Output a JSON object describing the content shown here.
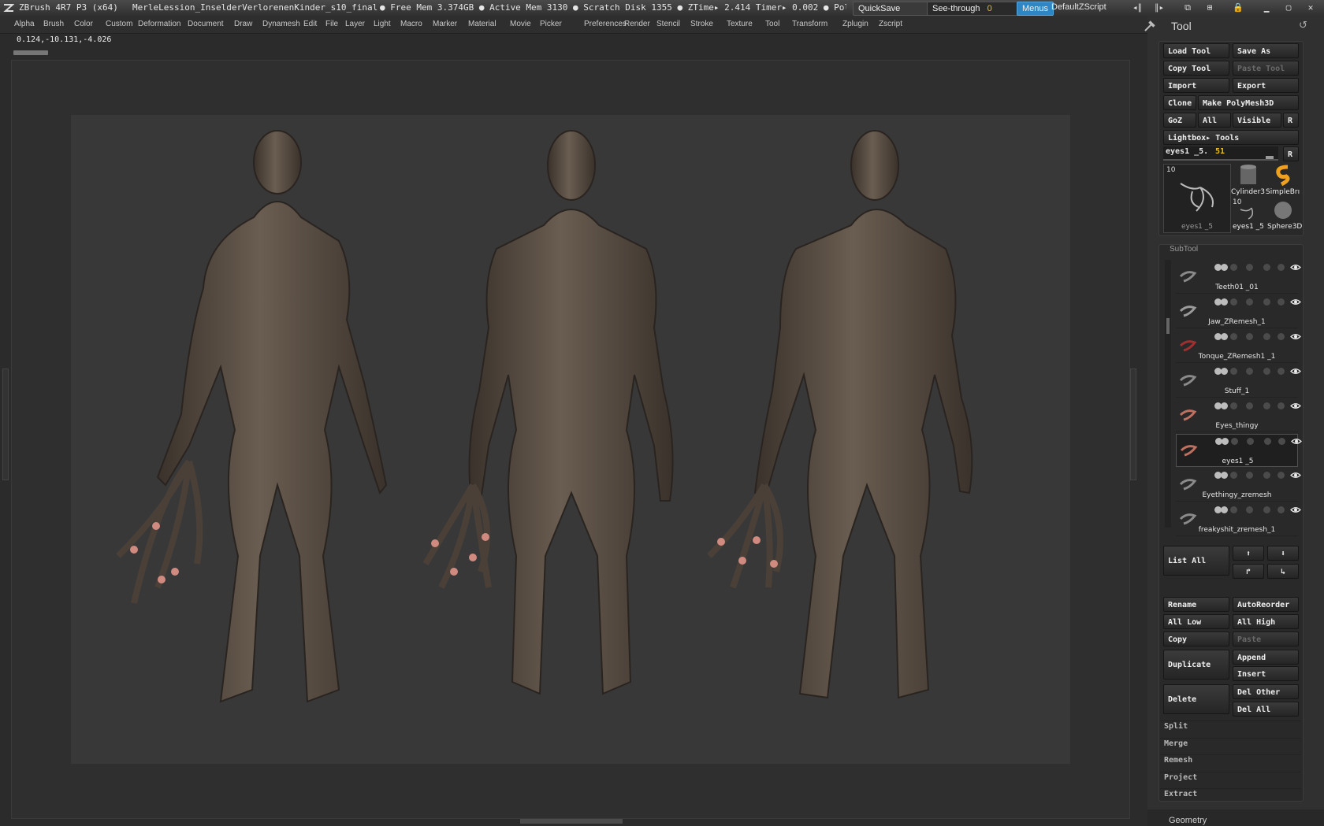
{
  "titlebar": {
    "app": "ZBrush 4R7 P3 (x64)",
    "document": "MerleLession_InselderVerlorenenKinder_s10_final",
    "stats": "● Free Mem 3.374GB ● Active Mem 3130 ● Scratch Disk 1355 ● ZTime▸ 2.414 Timer▸ 0.002 ● PolyC",
    "quicksave": "QuickSave",
    "see_through": "See-through",
    "see_through_value": "0",
    "menus": "Menus",
    "script": "DefaultZScript"
  },
  "menubar": [
    "Alpha",
    "Brush",
    "Color",
    "Custom",
    "Deformation",
    "Document",
    "Draw",
    "Dynamesh",
    "Edit",
    "File",
    "Layer",
    "Light",
    "Macro",
    "Marker",
    "Material",
    "Movie",
    "Picker",
    "Preferences",
    "Render",
    "Stencil",
    "Stroke",
    "Texture",
    "Tool",
    "Transform",
    "Zplugin",
    "Zscript"
  ],
  "coords": "0.124,-10.131,-4.026",
  "panel": {
    "title": "Tool",
    "buttons": {
      "load_tool": "Load Tool",
      "save_as": "Save As",
      "copy_tool": "Copy Tool",
      "paste_tool": "Paste Tool",
      "import": "Import",
      "export": "Export",
      "clone": "Clone",
      "make_polymesh": "Make PolyMesh3D",
      "goz": "GoZ",
      "all": "All",
      "visible": "Visible",
      "r": "R",
      "lightbox_tools": "Lightbox▸ Tools"
    },
    "current_tool": "eyes1 _5.",
    "current_tool_value": "51",
    "thumbs": {
      "main_count": "10",
      "main_label": "eyes1 _5",
      "cylinder": "Cylinder3",
      "simplebrush": "SimpleBrı",
      "small_count": "10",
      "small_label": "eyes1 _5",
      "sphere": "Sphere3D"
    }
  },
  "subtool": {
    "header": "SubTool",
    "items": [
      {
        "name": "Teeth01 _01"
      },
      {
        "name": "Jaw_ZRemesh_1"
      },
      {
        "name": "Tonque_ZRemesh1 _1"
      },
      {
        "name": "Stuff_1"
      },
      {
        "name": "Eyes_thingy"
      },
      {
        "name": "eyes1 _5"
      },
      {
        "name": "Eyethingy_zremesh"
      },
      {
        "name": "freakyshit_zremesh_1"
      }
    ],
    "list_all": "List All",
    "actions": {
      "rename": "Rename",
      "autoreorder": "AutoReorder",
      "all_low": "All Low",
      "all_high": "All High",
      "copy": "Copy",
      "paste": "Paste",
      "duplicate": "Duplicate",
      "append": "Append",
      "insert": "Insert",
      "delete": "Delete",
      "del_other": "Del Other",
      "del_all": "Del All"
    },
    "sections": [
      "Split",
      "Merge",
      "Remesh",
      "Project",
      "Extract"
    ],
    "geometry": "Geometry"
  }
}
